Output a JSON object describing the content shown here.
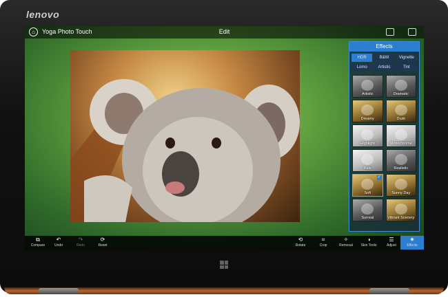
{
  "device": {
    "brand": "lenovo"
  },
  "topbar": {
    "app_title": "Yoga Photo Touch",
    "mode_title": "Edit",
    "home_icon": "home-icon",
    "camera_icon": "camera-icon",
    "window_icon": "window-icon"
  },
  "effects": {
    "title": "Effects",
    "tabs": [
      {
        "label": "HDR",
        "active": true
      },
      {
        "label": "B&W",
        "active": false
      },
      {
        "label": "Vignette",
        "active": false
      },
      {
        "label": "Lomo",
        "active": false
      },
      {
        "label": "Artistic",
        "active": false
      },
      {
        "label": "Tint",
        "active": false
      }
    ],
    "items": [
      {
        "label": "Artistic"
      },
      {
        "label": "Dramatic"
      },
      {
        "label": "Dreamy"
      },
      {
        "label": "Dusk"
      },
      {
        "label": "Highlight"
      },
      {
        "label": "Monochrome"
      },
      {
        "label": "Pale"
      },
      {
        "label": "Realistic"
      },
      {
        "label": "Soft",
        "selected": true
      },
      {
        "label": "Sunny Day"
      },
      {
        "label": "Surreal"
      },
      {
        "label": "Vibrant Scenery"
      }
    ]
  },
  "toolbar": {
    "left": [
      {
        "label": "Compare",
        "icon": "compare-icon",
        "glyph": "⧉"
      },
      {
        "label": "Undo",
        "icon": "undo-icon",
        "glyph": "↶"
      },
      {
        "label": "Redo",
        "icon": "redo-icon",
        "glyph": "↷",
        "disabled": true
      },
      {
        "label": "Reset",
        "icon": "reset-icon",
        "glyph": "⟳"
      }
    ],
    "right": [
      {
        "label": "Rotate",
        "icon": "rotate-icon",
        "glyph": "⟲"
      },
      {
        "label": "Crop",
        "icon": "crop-icon",
        "glyph": "⌗"
      },
      {
        "label": "Removal",
        "icon": "removal-icon",
        "glyph": "✧"
      },
      {
        "label": "Skin Tools",
        "icon": "skin-tools-icon",
        "glyph": "◑"
      },
      {
        "label": "Adjust",
        "icon": "adjust-icon",
        "glyph": "☰"
      },
      {
        "label": "Effects",
        "icon": "effects-icon",
        "glyph": "✷",
        "active": true
      }
    ]
  },
  "colors": {
    "accent": "#2c7fd0",
    "hinge": "#b8652b"
  }
}
